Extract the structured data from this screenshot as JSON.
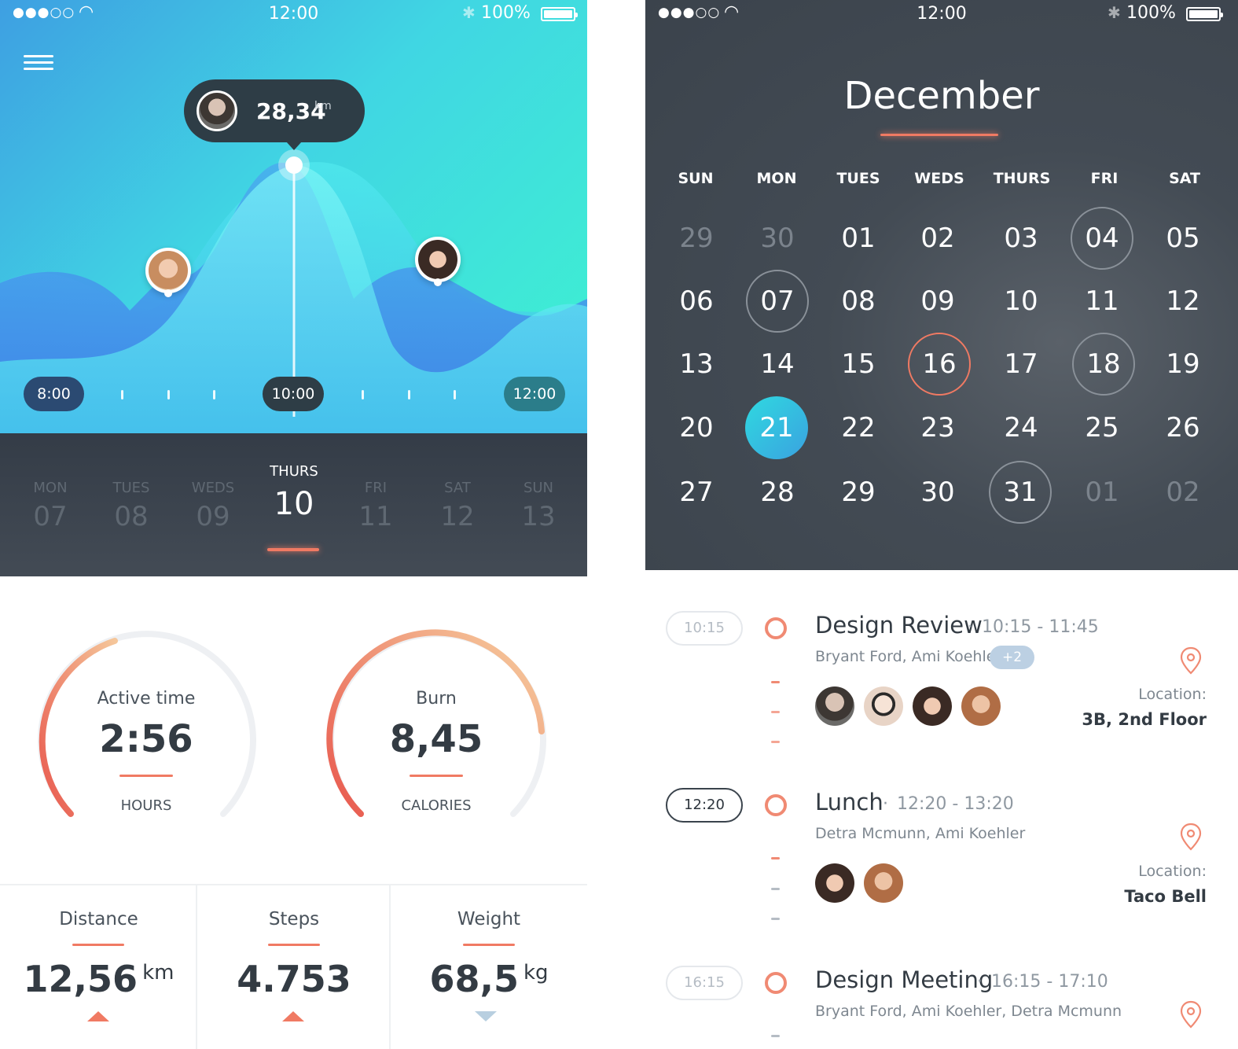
{
  "left": {
    "status": {
      "time": "12:00",
      "battery": "100%"
    },
    "tooltip": {
      "value": "28,34",
      "unit": "km"
    },
    "timeline": {
      "start": "8:00",
      "current": "10:00",
      "end": "12:00"
    },
    "days": [
      {
        "name": "MON",
        "num": "07"
      },
      {
        "name": "TUES",
        "num": "08"
      },
      {
        "name": "WEDS",
        "num": "09"
      },
      {
        "name": "THURS",
        "num": "10",
        "active": true
      },
      {
        "name": "FRI",
        "num": "11"
      },
      {
        "name": "SAT",
        "num": "12"
      },
      {
        "name": "SUN",
        "num": "13"
      }
    ],
    "gauges": [
      {
        "label": "Active time",
        "value": "2:56",
        "unit": "HOURS"
      },
      {
        "label": "Burn",
        "value": "8,45",
        "unit": "CALORIES"
      }
    ],
    "stats": [
      {
        "label": "Distance",
        "value": "12,56",
        "unit": "km",
        "trend": "up"
      },
      {
        "label": "Steps",
        "value": "4.753",
        "unit": "",
        "trend": "up"
      },
      {
        "label": "Weight",
        "value": "68,5",
        "unit": "kg",
        "trend": "down"
      }
    ],
    "colors": {
      "accent": "#f07a63",
      "dark": "#2e3d46",
      "pill": "#2b4a72"
    }
  },
  "right": {
    "status": {
      "time": "12:00",
      "battery": "100%"
    },
    "month": "December",
    "weekdays": [
      "SUN",
      "MON",
      "TUES",
      "WEDS",
      "THURS",
      "FRI",
      "SAT"
    ],
    "weeks": [
      [
        "29",
        "30",
        "01",
        "02",
        "03",
        "04",
        "05"
      ],
      [
        "06",
        "07",
        "08",
        "09",
        "10",
        "11",
        "12"
      ],
      [
        "13",
        "14",
        "15",
        "16",
        "17",
        "18",
        "19"
      ],
      [
        "20",
        "21",
        "22",
        "23",
        "24",
        "25",
        "26"
      ],
      [
        "27",
        "28",
        "29",
        "30",
        "31",
        "01",
        "02"
      ]
    ],
    "events": [
      {
        "pill": "10:15",
        "title": "Design Review",
        "time": "10:15 - 11:45",
        "people": "Bryant Ford, Ami Koehler",
        "more": "+2",
        "location_label": "Location:",
        "location": "3B, 2nd Floor"
      },
      {
        "pill": "12:20",
        "title": "Lunch",
        "time": "12:20 - 13:20",
        "people": "Detra Mcmunn, Ami Koehler",
        "location_label": "Location:",
        "location": "Taco Bell"
      },
      {
        "pill": "16:15",
        "title": "Design Meeting",
        "time": "16:15 - 17:10",
        "people": "Bryant Ford, Ami Koehler, Detra Mcmunn"
      }
    ]
  }
}
